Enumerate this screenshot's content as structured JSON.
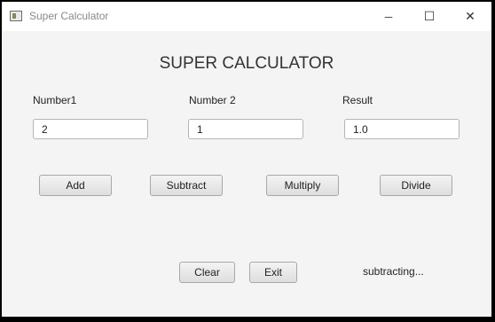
{
  "window": {
    "title": "Super Calculator",
    "minimize_glyph": "─",
    "maximize_glyph": "☐",
    "close_glyph": "✕",
    "icon": "app-window-icon"
  },
  "heading": "SUPER CALCULATOR",
  "fields": {
    "number1": {
      "label": "Number1",
      "value": "2"
    },
    "number2": {
      "label": "Number 2",
      "value": "1"
    },
    "result": {
      "label": "Result",
      "value": "1.0"
    }
  },
  "operations": {
    "add": "Add",
    "subtract": "Subtract",
    "multiply": "Multiply",
    "divide": "Divide"
  },
  "footer": {
    "clear": "Clear",
    "exit": "Exit",
    "status": "subtracting..."
  }
}
